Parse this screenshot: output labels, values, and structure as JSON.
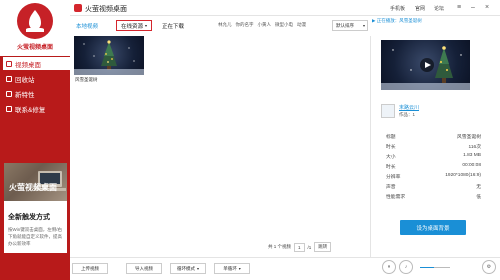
{
  "app": {
    "title": "火萤视频桌面",
    "logo_text": "火萤视频桌面"
  },
  "titlebar": {
    "links": [
      "手机板",
      "官网",
      "论坛"
    ]
  },
  "sidebar": {
    "items": [
      {
        "label": "视频桌面",
        "active": true
      },
      {
        "label": "回收站",
        "active": false
      },
      {
        "label": "新特性",
        "active": false
      },
      {
        "label": "联系&修复",
        "active": false
      }
    ],
    "promo": {
      "image_title": "火萤视频桌面",
      "heading": "全新触发方式",
      "desc": "按Win键双击桌面，左侧/右下角就能自定义软件，提高办公新效率"
    }
  },
  "tabs": {
    "local": "本地视频",
    "online": "在线资源",
    "downloading": "正在下载"
  },
  "categories": [
    "林允儿",
    "你的名字",
    "小黄人",
    "微型小电",
    "动漫"
  ],
  "sort": {
    "value": "默认排序"
  },
  "items": [
    {
      "label": "风雪圣诞树"
    }
  ],
  "pager": {
    "total_text": "共 1 个视频",
    "current_page": "1",
    "total_pages": "/1",
    "jump": "跳转"
  },
  "bottombar": {
    "upload": "上传视频",
    "import": "导入视频",
    "play_mode": "循环模式",
    "single": "单循环"
  },
  "right_panel": {
    "status": "正在播放：风雪圣诞树",
    "author_name": "末路云川",
    "author_works": "作品：1",
    "info": [
      {
        "label": "标题",
        "value": "风雪圣诞树"
      },
      {
        "label": "时长",
        "value": "116次"
      },
      {
        "label": "大小",
        "value": "1.83 MB"
      },
      {
        "label": "时长",
        "value": "00:00:08"
      },
      {
        "label": "分辨率",
        "value": "1920*1080(16:9)"
      },
      {
        "label": "声音",
        "value": "无"
      },
      {
        "label": "性能需求",
        "value": "低"
      }
    ],
    "set_bg_button": "设为桌面背景"
  },
  "player": {
    "volume": 0.45
  },
  "colors": {
    "brand_red": "#c62127",
    "accent_blue": "#1a8fd6"
  }
}
